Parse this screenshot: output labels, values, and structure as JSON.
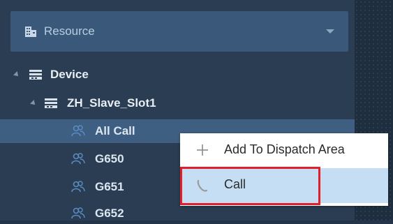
{
  "resource_dropdown": {
    "label": "Resource",
    "icon": "building-icon"
  },
  "tree": {
    "device": {
      "label": "Device",
      "icon": "device-icon"
    },
    "slot": {
      "label": "ZH_Slave_Slot1",
      "icon": "device-icon"
    },
    "groups": [
      {
        "label": "All Call",
        "icon": "group-icon",
        "selected": true
      },
      {
        "label": "G650",
        "icon": "group-icon"
      },
      {
        "label": "G651",
        "icon": "group-icon"
      },
      {
        "label": "G652",
        "icon": "group-icon"
      }
    ]
  },
  "context_menu": {
    "items": [
      {
        "label": "Add To Dispatch Area",
        "icon": "plus-icon"
      },
      {
        "label": "Call",
        "icon": "phone-icon",
        "highlighted": true
      }
    ]
  },
  "colors": {
    "panel": "#2a3d53",
    "dropdown": "#39587a",
    "selected_row": "#3f5f82",
    "menu_hover": "#c6def4",
    "highlight_border": "#e11e2a"
  }
}
